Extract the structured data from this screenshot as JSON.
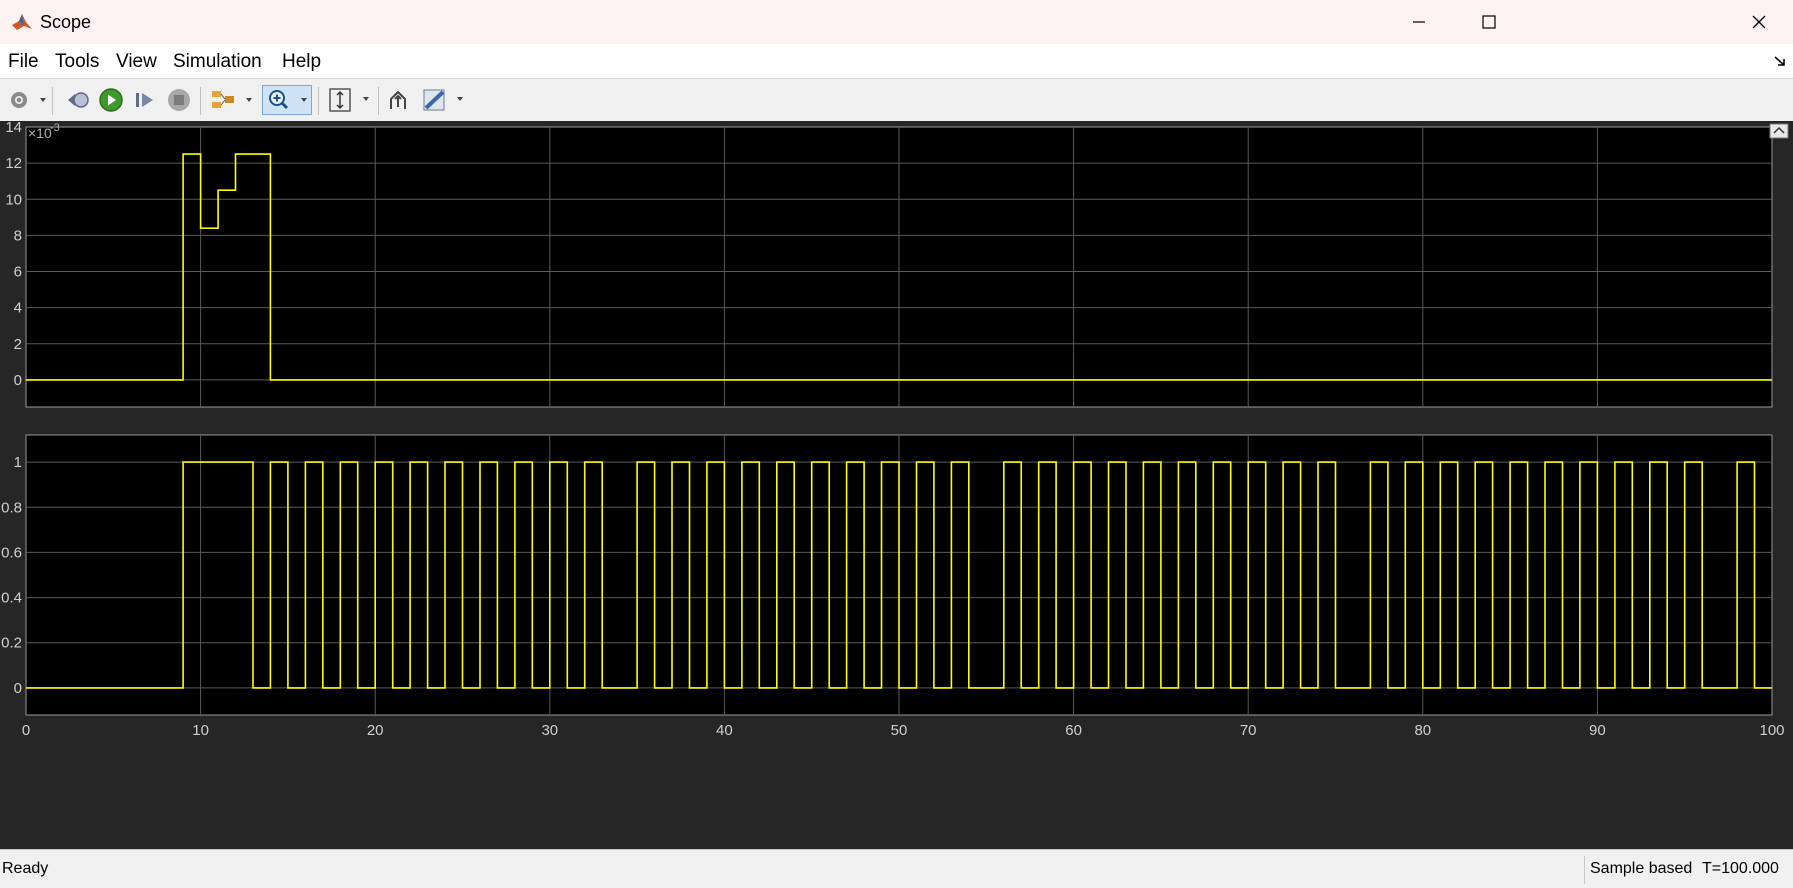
{
  "window": {
    "title": "Scope",
    "app_icon": "matlab-icon",
    "controls": [
      "minimize-icon",
      "maximize-icon",
      "close-icon"
    ]
  },
  "menu": {
    "items": [
      "File",
      "Tools",
      "View",
      "Simulation",
      "Help"
    ],
    "undock_icon": "undock-arrow-icon"
  },
  "toolbar": {
    "buttons": [
      "settings-icon",
      "step-back-icon",
      "run-icon",
      "step-forward-icon",
      "stop-icon",
      "signal-selector-icon",
      "zoom-in-icon",
      "autoscale-icon",
      "highlight-block-icon",
      "measurements-icon"
    ],
    "zoom_active": true
  },
  "status": {
    "text": "Ready",
    "mode": "Sample based",
    "time": "T=100.000"
  },
  "colors": {
    "trace": "#ffff00",
    "axes_background": "#000000",
    "figure_background": "#262626",
    "grid": "#5a5a5a",
    "tick_text": "#cfcfcf"
  },
  "chart_data": [
    {
      "type": "line",
      "step": true,
      "exponent_label": "×10^-3",
      "exponent_base": "×10",
      "exponent_power": "-3",
      "xlim": [
        0,
        100
      ],
      "ylim": [
        -1.5,
        14
      ],
      "yticks": [
        0,
        2,
        4,
        6,
        8,
        10,
        12,
        14
      ],
      "xticks": [
        10,
        20,
        30,
        40,
        50,
        60,
        70,
        80,
        90,
        100
      ],
      "grid": true,
      "x": [
        0,
        9,
        9,
        10,
        10,
        11,
        11,
        12,
        12,
        14,
        14,
        100
      ],
      "y": [
        0,
        0,
        12.5,
        12.5,
        8.4,
        8.4,
        10.5,
        10.5,
        12.5,
        12.5,
        0,
        0
      ]
    },
    {
      "type": "line",
      "step": true,
      "xlim": [
        0,
        100
      ],
      "ylim": [
        -0.12,
        1.12
      ],
      "yticks": [
        0,
        0.2,
        0.4,
        0.6,
        0.8,
        1
      ],
      "ytick_labels": [
        "0",
        "0.2",
        "0.4",
        "0.6",
        "0.8",
        "1"
      ],
      "xticks": [
        0,
        10,
        20,
        30,
        40,
        50,
        60,
        70,
        80,
        90,
        100
      ],
      "grid": true,
      "pulses": [
        [
          9,
          13
        ],
        [
          14,
          15
        ],
        [
          16,
          17
        ],
        [
          18,
          19
        ],
        [
          20,
          21
        ],
        [
          22,
          23
        ],
        [
          24,
          25
        ],
        [
          26,
          27
        ],
        [
          28,
          29
        ],
        [
          30,
          31
        ],
        [
          32,
          33
        ],
        [
          35,
          36
        ],
        [
          37,
          38
        ],
        [
          39,
          40
        ],
        [
          41,
          42
        ],
        [
          43,
          44
        ],
        [
          45,
          46
        ],
        [
          47,
          48
        ],
        [
          49,
          50
        ],
        [
          51,
          52
        ],
        [
          53,
          54
        ],
        [
          56,
          57
        ],
        [
          58,
          59
        ],
        [
          60,
          61
        ],
        [
          62,
          63
        ],
        [
          64,
          65
        ],
        [
          66,
          67
        ],
        [
          68,
          69
        ],
        [
          70,
          71
        ],
        [
          72,
          73
        ],
        [
          74,
          75
        ],
        [
          77,
          78
        ],
        [
          79,
          80
        ],
        [
          81,
          82
        ],
        [
          83,
          84
        ],
        [
          85,
          86
        ],
        [
          87,
          88
        ],
        [
          89,
          90
        ],
        [
          91,
          92
        ],
        [
          93,
          94
        ],
        [
          95,
          96
        ],
        [
          98,
          99
        ]
      ]
    }
  ]
}
